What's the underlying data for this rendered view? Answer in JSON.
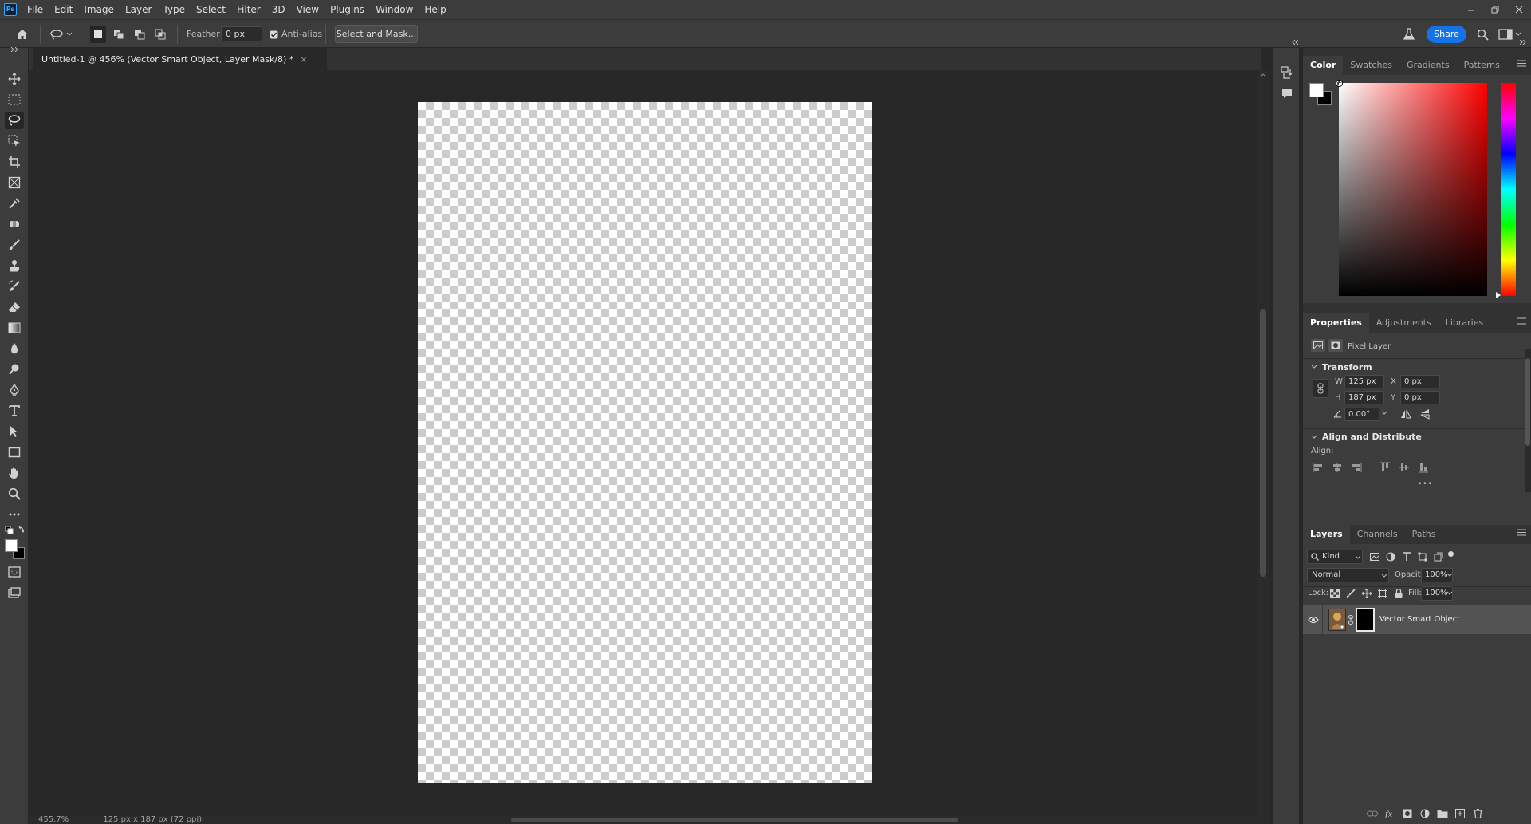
{
  "app": {
    "logo": "Ps"
  },
  "menubar": {
    "items": [
      "File",
      "Edit",
      "Image",
      "Layer",
      "Type",
      "Select",
      "Filter",
      "3D",
      "View",
      "Plugins",
      "Window",
      "Help"
    ]
  },
  "options": {
    "feather_label": "Feather:",
    "feather_value": "0 px",
    "antialias_label": "Anti-alias",
    "antialias_checked": true,
    "select_mask_label": "Select and Mask...",
    "share_label": "Share"
  },
  "document": {
    "tab_title": "Untitled-1 @ 456% (Vector Smart Object, Layer Mask/8) *",
    "close_glyph": "×",
    "status_zoom": "455.7%",
    "status_info": "125 px x 187 px (72 ppi)"
  },
  "color_panel": {
    "tabs": [
      "Color",
      "Swatches",
      "Gradients",
      "Patterns"
    ],
    "active": "Color",
    "foreground": "#ffffff",
    "background": "#000000",
    "hue_color": "#ff0000"
  },
  "properties_panel": {
    "tabs": [
      "Properties",
      "Adjustments",
      "Libraries"
    ],
    "active": "Properties",
    "layer_type": "Pixel Layer",
    "transform_title": "Transform",
    "w_label": "W",
    "w_value": "125 px",
    "h_label": "H",
    "h_value": "187 px",
    "x_label": "X",
    "x_value": "0 px",
    "y_label": "Y",
    "y_value": "0 px",
    "angle_value": "0.00°",
    "align_title": "Align and Distribute",
    "align_label": "Align:",
    "more_glyph": "•••"
  },
  "layers_panel": {
    "tabs": [
      "Layers",
      "Channels",
      "Paths"
    ],
    "active": "Layers",
    "filter_kind": "Kind",
    "blend_mode": "Normal",
    "opacity_label": "Opacity:",
    "opacity_value": "100%",
    "lock_label": "Lock:",
    "fill_label": "Fill:",
    "fill_value": "100%",
    "layers": [
      {
        "name": "Vector Smart Object",
        "visible": true,
        "selected": true
      }
    ]
  },
  "colors": {
    "accent": "#1473e6",
    "panel": "#3c3c3c",
    "canvas_bg": "#282828"
  }
}
